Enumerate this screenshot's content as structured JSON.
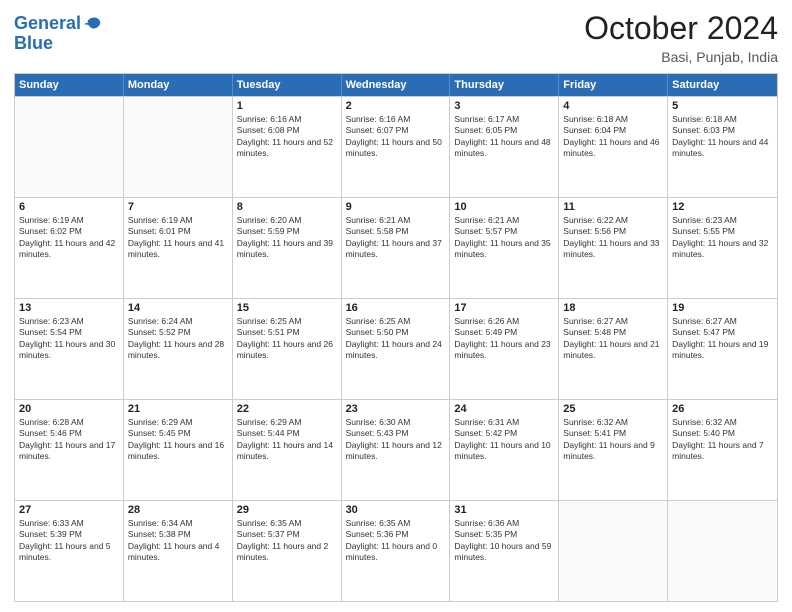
{
  "header": {
    "logo_line1": "General",
    "logo_line2": "Blue",
    "month": "October 2024",
    "location": "Basi, Punjab, India"
  },
  "weekdays": [
    "Sunday",
    "Monday",
    "Tuesday",
    "Wednesday",
    "Thursday",
    "Friday",
    "Saturday"
  ],
  "rows": [
    [
      {
        "day": "",
        "sunrise": "",
        "sunset": "",
        "daylight": ""
      },
      {
        "day": "",
        "sunrise": "",
        "sunset": "",
        "daylight": ""
      },
      {
        "day": "1",
        "sunrise": "Sunrise: 6:16 AM",
        "sunset": "Sunset: 6:08 PM",
        "daylight": "Daylight: 11 hours and 52 minutes."
      },
      {
        "day": "2",
        "sunrise": "Sunrise: 6:16 AM",
        "sunset": "Sunset: 6:07 PM",
        "daylight": "Daylight: 11 hours and 50 minutes."
      },
      {
        "day": "3",
        "sunrise": "Sunrise: 6:17 AM",
        "sunset": "Sunset: 6:05 PM",
        "daylight": "Daylight: 11 hours and 48 minutes."
      },
      {
        "day": "4",
        "sunrise": "Sunrise: 6:18 AM",
        "sunset": "Sunset: 6:04 PM",
        "daylight": "Daylight: 11 hours and 46 minutes."
      },
      {
        "day": "5",
        "sunrise": "Sunrise: 6:18 AM",
        "sunset": "Sunset: 6:03 PM",
        "daylight": "Daylight: 11 hours and 44 minutes."
      }
    ],
    [
      {
        "day": "6",
        "sunrise": "Sunrise: 6:19 AM",
        "sunset": "Sunset: 6:02 PM",
        "daylight": "Daylight: 11 hours and 42 minutes."
      },
      {
        "day": "7",
        "sunrise": "Sunrise: 6:19 AM",
        "sunset": "Sunset: 6:01 PM",
        "daylight": "Daylight: 11 hours and 41 minutes."
      },
      {
        "day": "8",
        "sunrise": "Sunrise: 6:20 AM",
        "sunset": "Sunset: 5:59 PM",
        "daylight": "Daylight: 11 hours and 39 minutes."
      },
      {
        "day": "9",
        "sunrise": "Sunrise: 6:21 AM",
        "sunset": "Sunset: 5:58 PM",
        "daylight": "Daylight: 11 hours and 37 minutes."
      },
      {
        "day": "10",
        "sunrise": "Sunrise: 6:21 AM",
        "sunset": "Sunset: 5:57 PM",
        "daylight": "Daylight: 11 hours and 35 minutes."
      },
      {
        "day": "11",
        "sunrise": "Sunrise: 6:22 AM",
        "sunset": "Sunset: 5:56 PM",
        "daylight": "Daylight: 11 hours and 33 minutes."
      },
      {
        "day": "12",
        "sunrise": "Sunrise: 6:23 AM",
        "sunset": "Sunset: 5:55 PM",
        "daylight": "Daylight: 11 hours and 32 minutes."
      }
    ],
    [
      {
        "day": "13",
        "sunrise": "Sunrise: 6:23 AM",
        "sunset": "Sunset: 5:54 PM",
        "daylight": "Daylight: 11 hours and 30 minutes."
      },
      {
        "day": "14",
        "sunrise": "Sunrise: 6:24 AM",
        "sunset": "Sunset: 5:52 PM",
        "daylight": "Daylight: 11 hours and 28 minutes."
      },
      {
        "day": "15",
        "sunrise": "Sunrise: 6:25 AM",
        "sunset": "Sunset: 5:51 PM",
        "daylight": "Daylight: 11 hours and 26 minutes."
      },
      {
        "day": "16",
        "sunrise": "Sunrise: 6:25 AM",
        "sunset": "Sunset: 5:50 PM",
        "daylight": "Daylight: 11 hours and 24 minutes."
      },
      {
        "day": "17",
        "sunrise": "Sunrise: 6:26 AM",
        "sunset": "Sunset: 5:49 PM",
        "daylight": "Daylight: 11 hours and 23 minutes."
      },
      {
        "day": "18",
        "sunrise": "Sunrise: 6:27 AM",
        "sunset": "Sunset: 5:48 PM",
        "daylight": "Daylight: 11 hours and 21 minutes."
      },
      {
        "day": "19",
        "sunrise": "Sunrise: 6:27 AM",
        "sunset": "Sunset: 5:47 PM",
        "daylight": "Daylight: 11 hours and 19 minutes."
      }
    ],
    [
      {
        "day": "20",
        "sunrise": "Sunrise: 6:28 AM",
        "sunset": "Sunset: 5:46 PM",
        "daylight": "Daylight: 11 hours and 17 minutes."
      },
      {
        "day": "21",
        "sunrise": "Sunrise: 6:29 AM",
        "sunset": "Sunset: 5:45 PM",
        "daylight": "Daylight: 11 hours and 16 minutes."
      },
      {
        "day": "22",
        "sunrise": "Sunrise: 6:29 AM",
        "sunset": "Sunset: 5:44 PM",
        "daylight": "Daylight: 11 hours and 14 minutes."
      },
      {
        "day": "23",
        "sunrise": "Sunrise: 6:30 AM",
        "sunset": "Sunset: 5:43 PM",
        "daylight": "Daylight: 11 hours and 12 minutes."
      },
      {
        "day": "24",
        "sunrise": "Sunrise: 6:31 AM",
        "sunset": "Sunset: 5:42 PM",
        "daylight": "Daylight: 11 hours and 10 minutes."
      },
      {
        "day": "25",
        "sunrise": "Sunrise: 6:32 AM",
        "sunset": "Sunset: 5:41 PM",
        "daylight": "Daylight: 11 hours and 9 minutes."
      },
      {
        "day": "26",
        "sunrise": "Sunrise: 6:32 AM",
        "sunset": "Sunset: 5:40 PM",
        "daylight": "Daylight: 11 hours and 7 minutes."
      }
    ],
    [
      {
        "day": "27",
        "sunrise": "Sunrise: 6:33 AM",
        "sunset": "Sunset: 5:39 PM",
        "daylight": "Daylight: 11 hours and 5 minutes."
      },
      {
        "day": "28",
        "sunrise": "Sunrise: 6:34 AM",
        "sunset": "Sunset: 5:38 PM",
        "daylight": "Daylight: 11 hours and 4 minutes."
      },
      {
        "day": "29",
        "sunrise": "Sunrise: 6:35 AM",
        "sunset": "Sunset: 5:37 PM",
        "daylight": "Daylight: 11 hours and 2 minutes."
      },
      {
        "day": "30",
        "sunrise": "Sunrise: 6:35 AM",
        "sunset": "Sunset: 5:36 PM",
        "daylight": "Daylight: 11 hours and 0 minutes."
      },
      {
        "day": "31",
        "sunrise": "Sunrise: 6:36 AM",
        "sunset": "Sunset: 5:35 PM",
        "daylight": "Daylight: 10 hours and 59 minutes."
      },
      {
        "day": "",
        "sunrise": "",
        "sunset": "",
        "daylight": ""
      },
      {
        "day": "",
        "sunrise": "",
        "sunset": "",
        "daylight": ""
      }
    ]
  ]
}
